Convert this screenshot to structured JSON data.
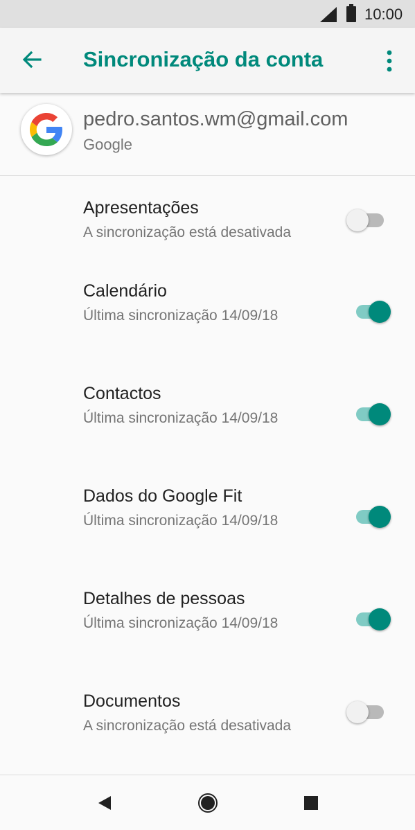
{
  "status_bar": {
    "time": "10:00",
    "icons": [
      "signal-icon",
      "battery-icon"
    ]
  },
  "app_bar": {
    "title": "Sincronização da conta",
    "back_icon": "arrow-left-icon",
    "menu_icon": "more-vert-icon"
  },
  "account": {
    "email": "pedro.santos.wm@gmail.com",
    "provider": "Google",
    "logo": "google-g-logo"
  },
  "sync_items": [
    {
      "title": "Apresentações",
      "subtitle": "A sincronização está desativada",
      "enabled": false
    },
    {
      "title": "Calendário",
      "subtitle": "Última sincronização 14/09/18",
      "enabled": true
    },
    {
      "title": "Contactos",
      "subtitle": "Última sincronização 14/09/18",
      "enabled": true
    },
    {
      "title": "Dados do Google Fit",
      "subtitle": "Última sincronização 14/09/18",
      "enabled": true
    },
    {
      "title": "Detalhes de pessoas",
      "subtitle": "Última sincronização 14/09/18",
      "enabled": true
    },
    {
      "title": "Documentos",
      "subtitle": "A sincronização está desativada",
      "enabled": false
    }
  ],
  "nav_bar": {
    "icons": [
      "back-triangle-icon",
      "home-circle-icon",
      "recents-square-icon"
    ]
  },
  "colors": {
    "accent": "#00897b",
    "accent_light": "#80cbc4",
    "status_bar": "#e0e0e0",
    "background": "#fafafa"
  }
}
